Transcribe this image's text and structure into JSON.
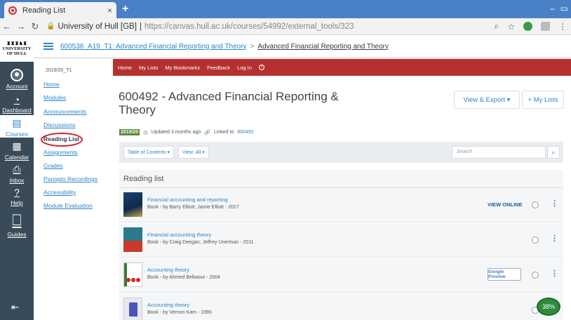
{
  "browser": {
    "tab_title": "Reading List",
    "tab_close": "×",
    "new_tab": "+",
    "url_site": "University of Hull [GB]",
    "url_sep": "|",
    "url": "https://canvas.hull.ac.uk/courses/54992/external_tools/323"
  },
  "global_nav": {
    "logo_lines": [
      "UNIVERSITY",
      "OF HULL"
    ],
    "items": [
      {
        "label": "Account",
        "icon": "account-icon"
      },
      {
        "label": "Dashboard",
        "icon": "dashboard-icon"
      },
      {
        "label": "Courses",
        "icon": "courses-icon"
      },
      {
        "label": "Calendar",
        "icon": "calendar-icon"
      },
      {
        "label": "Inbox",
        "icon": "inbox-icon"
      },
      {
        "label": "Help",
        "icon": "help-icon"
      },
      {
        "label": "Guides",
        "icon": "guides-icon"
      }
    ],
    "collapse": "⇤"
  },
  "breadcrumb": {
    "course": "600538_A19_T1: Advanced Financial Reporting and Theory",
    "separator": ">",
    "current": "Advanced Financial Reporting and Theory"
  },
  "course_nav": {
    "term": "2019/20_T1",
    "items": [
      "Home",
      "Modules",
      "Announcements",
      "Discussions",
      "Reading List",
      "Assignments",
      "Grades",
      "Panopto Recordings",
      "Accessibility",
      "Module Evaluation"
    ],
    "active": "Reading List"
  },
  "talis_nav": {
    "items": [
      "Home",
      "My Lists",
      "My Bookmarks",
      "Feedback",
      "Log In"
    ]
  },
  "list": {
    "title": "600492 - Advanced Financial Reporting & Theory",
    "view_export": "View & Export ▾",
    "my_lists": "+ My Lists",
    "year_badge": "2019/20",
    "updated": "Updated 3 months ago",
    "linked_to_label": "Linked to",
    "linked_to": "600492",
    "table_of_contents": "Table of Contents ▾",
    "view_all": "View: All ▾",
    "search_placeholder": "Search",
    "section_title": "Reading list",
    "items": [
      {
        "title": "Financial accounting and reporting",
        "meta": "Book  -  by Barry Elliott; Jamie Elliott  -  2017",
        "action": "VIEW ONLINE"
      },
      {
        "title": "Financial accounting theory",
        "meta": "Book  -  by Craig Deegan; Jeffrey Unerman  -  2011",
        "action": ""
      },
      {
        "title": "Accounting theory",
        "meta": "Book  -  by Ahmed Belkaoui  -  2004",
        "action": "Google Preview"
      },
      {
        "title": "Accounting theory",
        "meta": "Book  -  by Vernon Kam  -  1990",
        "action": ""
      }
    ]
  },
  "progress_badge": "38%"
}
